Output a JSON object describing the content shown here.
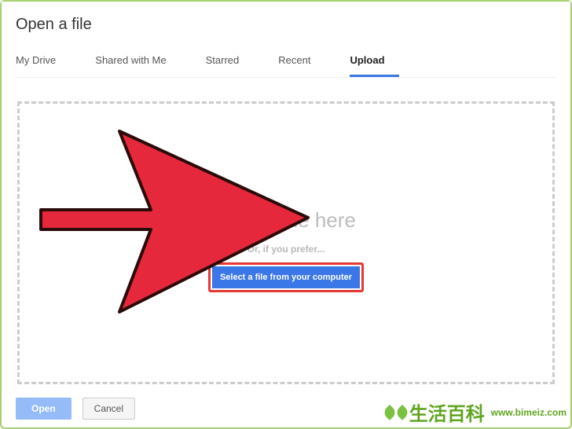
{
  "dialog": {
    "title": "Open a file",
    "tabs": [
      {
        "label": "My Drive",
        "active": false
      },
      {
        "label": "Shared with Me",
        "active": false
      },
      {
        "label": "Starred",
        "active": false
      },
      {
        "label": "Recent",
        "active": false
      },
      {
        "label": "Upload",
        "active": true
      }
    ],
    "dropzone": {
      "main_text": "Drag a file here",
      "sub_text": "Or, if you prefer...",
      "select_button": "Select a file from your computer"
    },
    "footer": {
      "open_label": "Open",
      "cancel_label": "Cancel"
    }
  },
  "watermark": {
    "cn": "生活百科",
    "url": "www.bimeiz.com"
  },
  "annotation": {
    "highlight_target": "select-file-button",
    "highlight_color": "#e53935",
    "arrow_color": "#e6283c"
  }
}
